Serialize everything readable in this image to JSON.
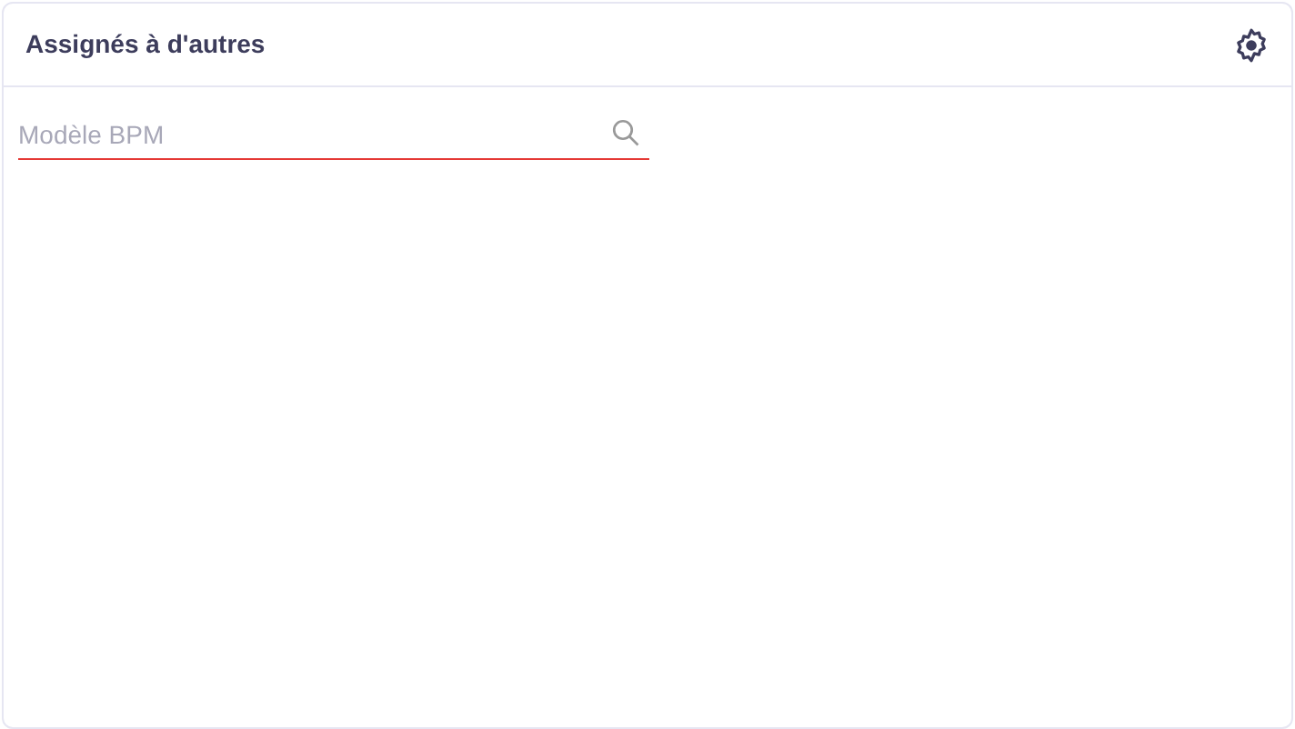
{
  "panel": {
    "title": "Assignés à d'autres"
  },
  "search": {
    "placeholder": "Modèle BPM"
  }
}
